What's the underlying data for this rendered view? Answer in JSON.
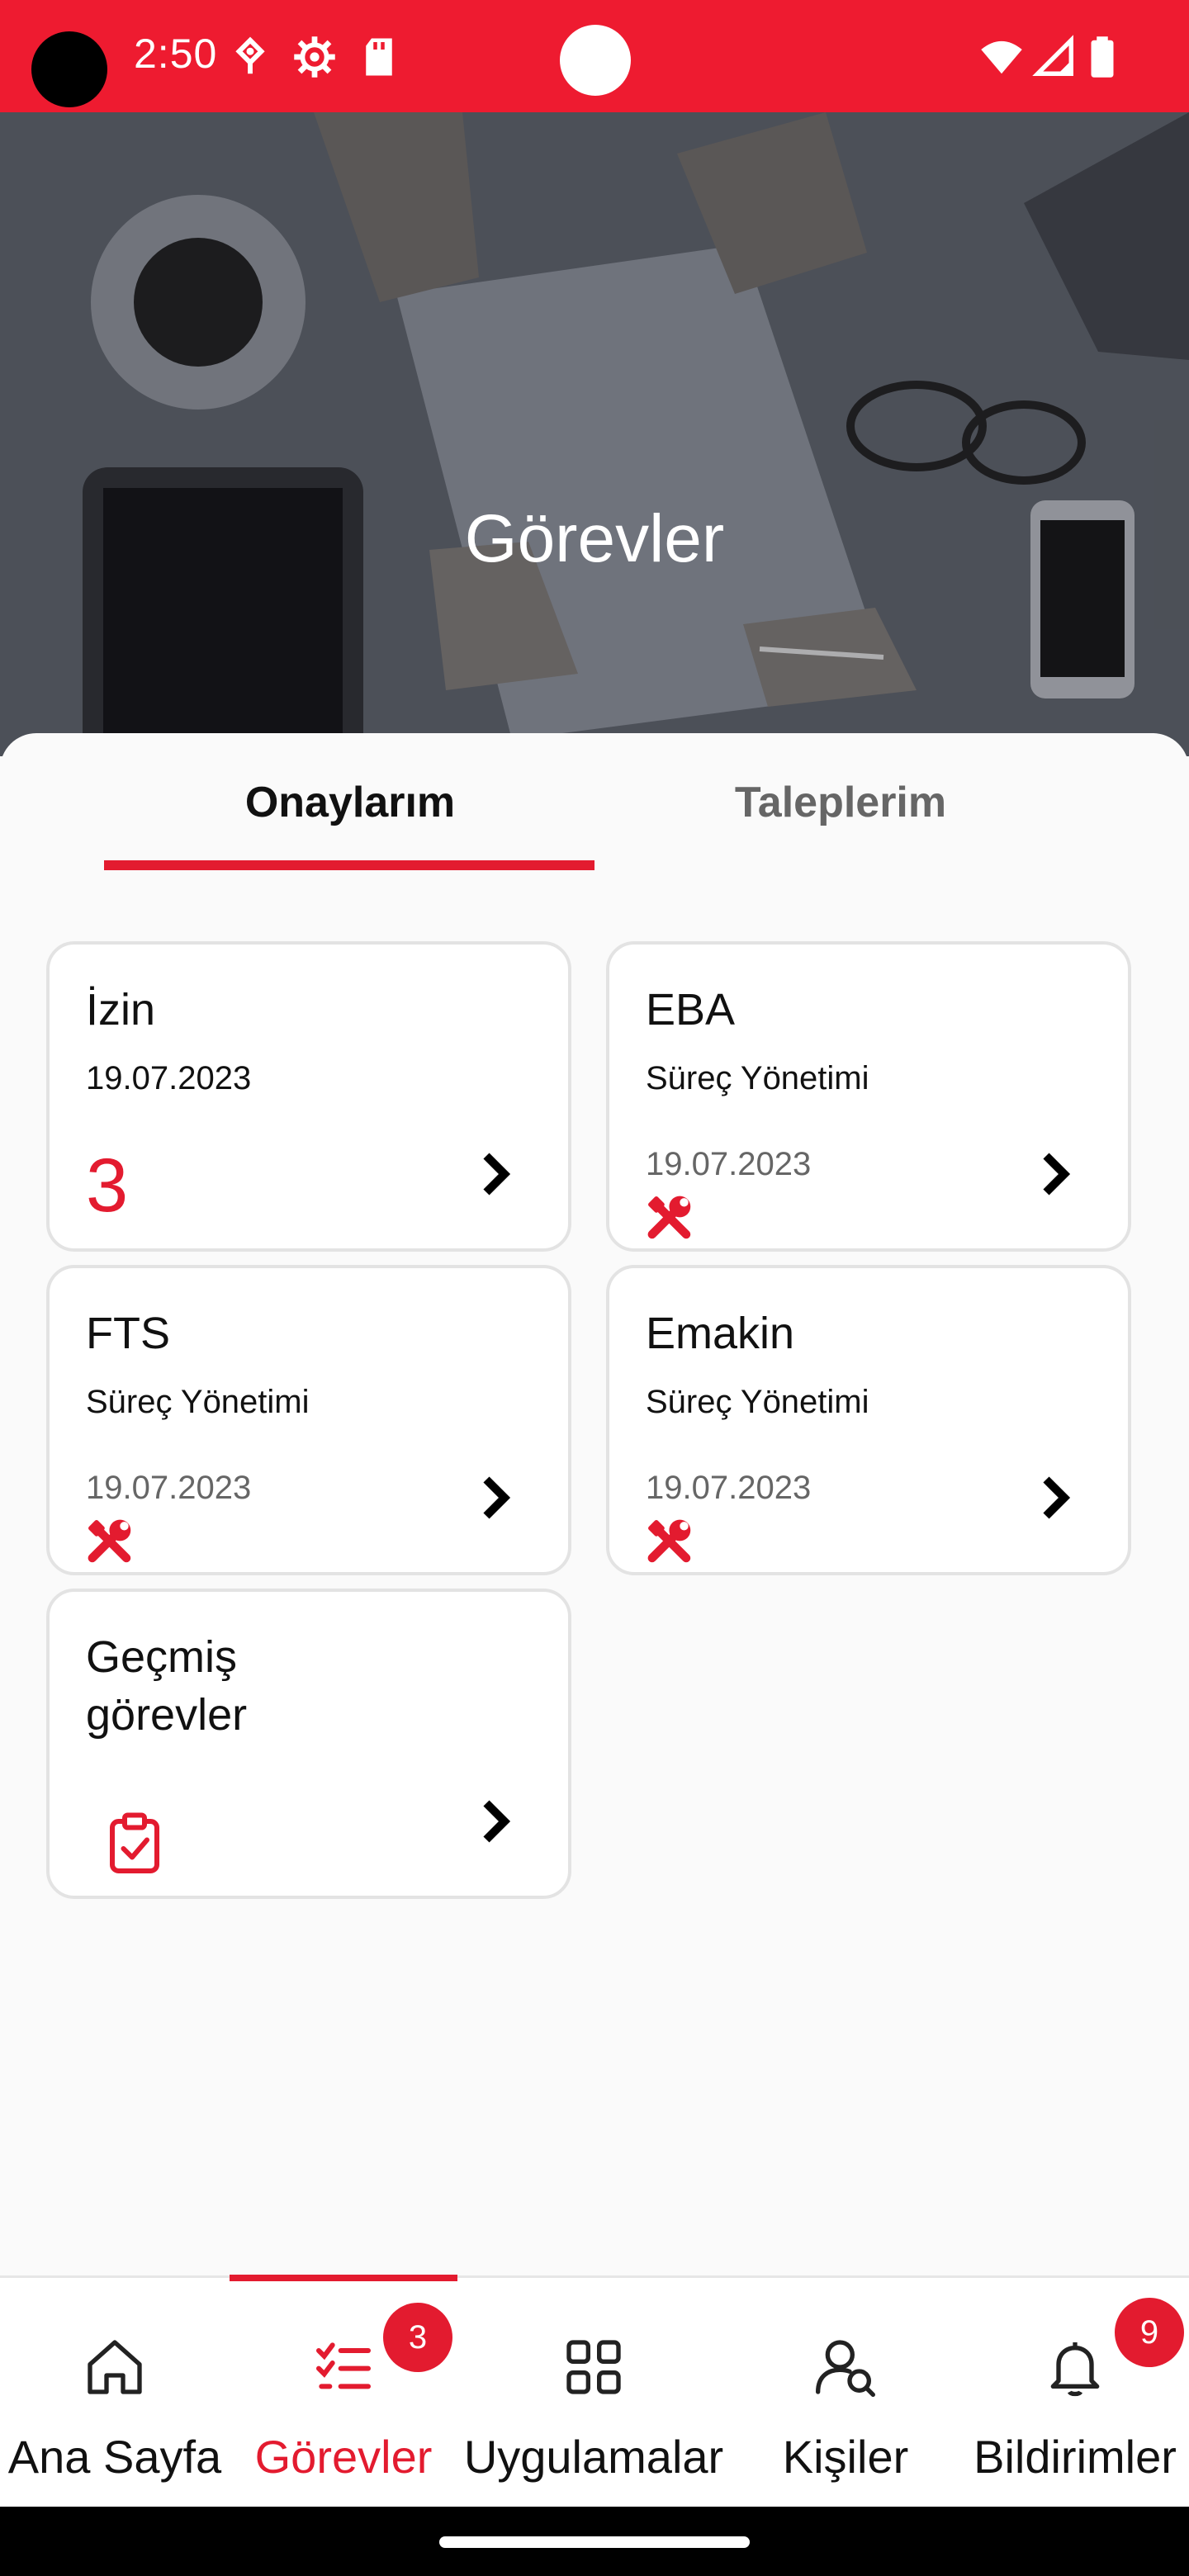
{
  "status_bar": {
    "time": "2:50",
    "background": "#ee1b30"
  },
  "hero": {
    "title": "Görevler"
  },
  "tabs": [
    {
      "label": "Onaylarım",
      "active": true
    },
    {
      "label": "Taleplerim",
      "active": false
    }
  ],
  "cards": {
    "izin": {
      "title": "İzin",
      "date": "19.07.2023",
      "count": "3"
    },
    "eba": {
      "title": "EBA",
      "subtitle": "Süreç Yönetimi",
      "date": "19.07.2023",
      "icon": "tools-icon"
    },
    "fts": {
      "title": "FTS",
      "subtitle": "Süreç Yönetimi",
      "date": "19.07.2023",
      "icon": "tools-icon"
    },
    "emakin": {
      "title": "Emakin",
      "subtitle": "Süreç Yönetimi",
      "date": "19.07.2023",
      "icon": "tools-icon"
    },
    "gecmis": {
      "title_line1": "Geçmiş",
      "title_line2": "görevler",
      "icon": "clipboard-check-icon"
    }
  },
  "bottom_nav": {
    "items": [
      {
        "label": "Ana Sayfa",
        "icon": "home-icon",
        "active": false
      },
      {
        "label": "Görevler",
        "icon": "task-list-icon",
        "active": true,
        "badge": "3"
      },
      {
        "label": "Uygulamalar",
        "icon": "grid-icon",
        "active": false
      },
      {
        "label": "Kişiler",
        "icon": "person-search-icon",
        "active": false
      },
      {
        "label": "Bildirimler",
        "icon": "bell-icon",
        "active": false,
        "badge": "9"
      }
    ]
  },
  "colors": {
    "accent": "#e31b2f",
    "text": "#111111",
    "muted": "#666666"
  }
}
